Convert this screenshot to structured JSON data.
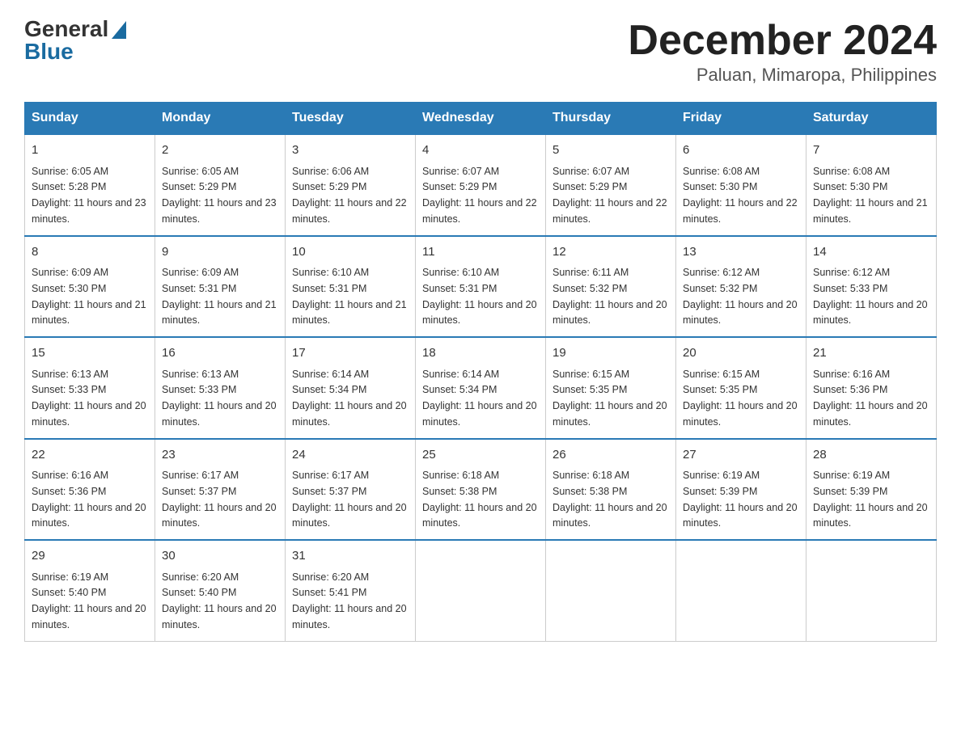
{
  "logo": {
    "general": "General",
    "blue": "Blue"
  },
  "title": "December 2024",
  "subtitle": "Paluan, Mimaropa, Philippines",
  "headers": [
    "Sunday",
    "Monday",
    "Tuesday",
    "Wednesday",
    "Thursday",
    "Friday",
    "Saturday"
  ],
  "weeks": [
    [
      {
        "day": "1",
        "sunrise": "Sunrise: 6:05 AM",
        "sunset": "Sunset: 5:28 PM",
        "daylight": "Daylight: 11 hours and 23 minutes."
      },
      {
        "day": "2",
        "sunrise": "Sunrise: 6:05 AM",
        "sunset": "Sunset: 5:29 PM",
        "daylight": "Daylight: 11 hours and 23 minutes."
      },
      {
        "day": "3",
        "sunrise": "Sunrise: 6:06 AM",
        "sunset": "Sunset: 5:29 PM",
        "daylight": "Daylight: 11 hours and 22 minutes."
      },
      {
        "day": "4",
        "sunrise": "Sunrise: 6:07 AM",
        "sunset": "Sunset: 5:29 PM",
        "daylight": "Daylight: 11 hours and 22 minutes."
      },
      {
        "day": "5",
        "sunrise": "Sunrise: 6:07 AM",
        "sunset": "Sunset: 5:29 PM",
        "daylight": "Daylight: 11 hours and 22 minutes."
      },
      {
        "day": "6",
        "sunrise": "Sunrise: 6:08 AM",
        "sunset": "Sunset: 5:30 PM",
        "daylight": "Daylight: 11 hours and 22 minutes."
      },
      {
        "day": "7",
        "sunrise": "Sunrise: 6:08 AM",
        "sunset": "Sunset: 5:30 PM",
        "daylight": "Daylight: 11 hours and 21 minutes."
      }
    ],
    [
      {
        "day": "8",
        "sunrise": "Sunrise: 6:09 AM",
        "sunset": "Sunset: 5:30 PM",
        "daylight": "Daylight: 11 hours and 21 minutes."
      },
      {
        "day": "9",
        "sunrise": "Sunrise: 6:09 AM",
        "sunset": "Sunset: 5:31 PM",
        "daylight": "Daylight: 11 hours and 21 minutes."
      },
      {
        "day": "10",
        "sunrise": "Sunrise: 6:10 AM",
        "sunset": "Sunset: 5:31 PM",
        "daylight": "Daylight: 11 hours and 21 minutes."
      },
      {
        "day": "11",
        "sunrise": "Sunrise: 6:10 AM",
        "sunset": "Sunset: 5:31 PM",
        "daylight": "Daylight: 11 hours and 20 minutes."
      },
      {
        "day": "12",
        "sunrise": "Sunrise: 6:11 AM",
        "sunset": "Sunset: 5:32 PM",
        "daylight": "Daylight: 11 hours and 20 minutes."
      },
      {
        "day": "13",
        "sunrise": "Sunrise: 6:12 AM",
        "sunset": "Sunset: 5:32 PM",
        "daylight": "Daylight: 11 hours and 20 minutes."
      },
      {
        "day": "14",
        "sunrise": "Sunrise: 6:12 AM",
        "sunset": "Sunset: 5:33 PM",
        "daylight": "Daylight: 11 hours and 20 minutes."
      }
    ],
    [
      {
        "day": "15",
        "sunrise": "Sunrise: 6:13 AM",
        "sunset": "Sunset: 5:33 PM",
        "daylight": "Daylight: 11 hours and 20 minutes."
      },
      {
        "day": "16",
        "sunrise": "Sunrise: 6:13 AM",
        "sunset": "Sunset: 5:33 PM",
        "daylight": "Daylight: 11 hours and 20 minutes."
      },
      {
        "day": "17",
        "sunrise": "Sunrise: 6:14 AM",
        "sunset": "Sunset: 5:34 PM",
        "daylight": "Daylight: 11 hours and 20 minutes."
      },
      {
        "day": "18",
        "sunrise": "Sunrise: 6:14 AM",
        "sunset": "Sunset: 5:34 PM",
        "daylight": "Daylight: 11 hours and 20 minutes."
      },
      {
        "day": "19",
        "sunrise": "Sunrise: 6:15 AM",
        "sunset": "Sunset: 5:35 PM",
        "daylight": "Daylight: 11 hours and 20 minutes."
      },
      {
        "day": "20",
        "sunrise": "Sunrise: 6:15 AM",
        "sunset": "Sunset: 5:35 PM",
        "daylight": "Daylight: 11 hours and 20 minutes."
      },
      {
        "day": "21",
        "sunrise": "Sunrise: 6:16 AM",
        "sunset": "Sunset: 5:36 PM",
        "daylight": "Daylight: 11 hours and 20 minutes."
      }
    ],
    [
      {
        "day": "22",
        "sunrise": "Sunrise: 6:16 AM",
        "sunset": "Sunset: 5:36 PM",
        "daylight": "Daylight: 11 hours and 20 minutes."
      },
      {
        "day": "23",
        "sunrise": "Sunrise: 6:17 AM",
        "sunset": "Sunset: 5:37 PM",
        "daylight": "Daylight: 11 hours and 20 minutes."
      },
      {
        "day": "24",
        "sunrise": "Sunrise: 6:17 AM",
        "sunset": "Sunset: 5:37 PM",
        "daylight": "Daylight: 11 hours and 20 minutes."
      },
      {
        "day": "25",
        "sunrise": "Sunrise: 6:18 AM",
        "sunset": "Sunset: 5:38 PM",
        "daylight": "Daylight: 11 hours and 20 minutes."
      },
      {
        "day": "26",
        "sunrise": "Sunrise: 6:18 AM",
        "sunset": "Sunset: 5:38 PM",
        "daylight": "Daylight: 11 hours and 20 minutes."
      },
      {
        "day": "27",
        "sunrise": "Sunrise: 6:19 AM",
        "sunset": "Sunset: 5:39 PM",
        "daylight": "Daylight: 11 hours and 20 minutes."
      },
      {
        "day": "28",
        "sunrise": "Sunrise: 6:19 AM",
        "sunset": "Sunset: 5:39 PM",
        "daylight": "Daylight: 11 hours and 20 minutes."
      }
    ],
    [
      {
        "day": "29",
        "sunrise": "Sunrise: 6:19 AM",
        "sunset": "Sunset: 5:40 PM",
        "daylight": "Daylight: 11 hours and 20 minutes."
      },
      {
        "day": "30",
        "sunrise": "Sunrise: 6:20 AM",
        "sunset": "Sunset: 5:40 PM",
        "daylight": "Daylight: 11 hours and 20 minutes."
      },
      {
        "day": "31",
        "sunrise": "Sunrise: 6:20 AM",
        "sunset": "Sunset: 5:41 PM",
        "daylight": "Daylight: 11 hours and 20 minutes."
      },
      null,
      null,
      null,
      null
    ]
  ]
}
